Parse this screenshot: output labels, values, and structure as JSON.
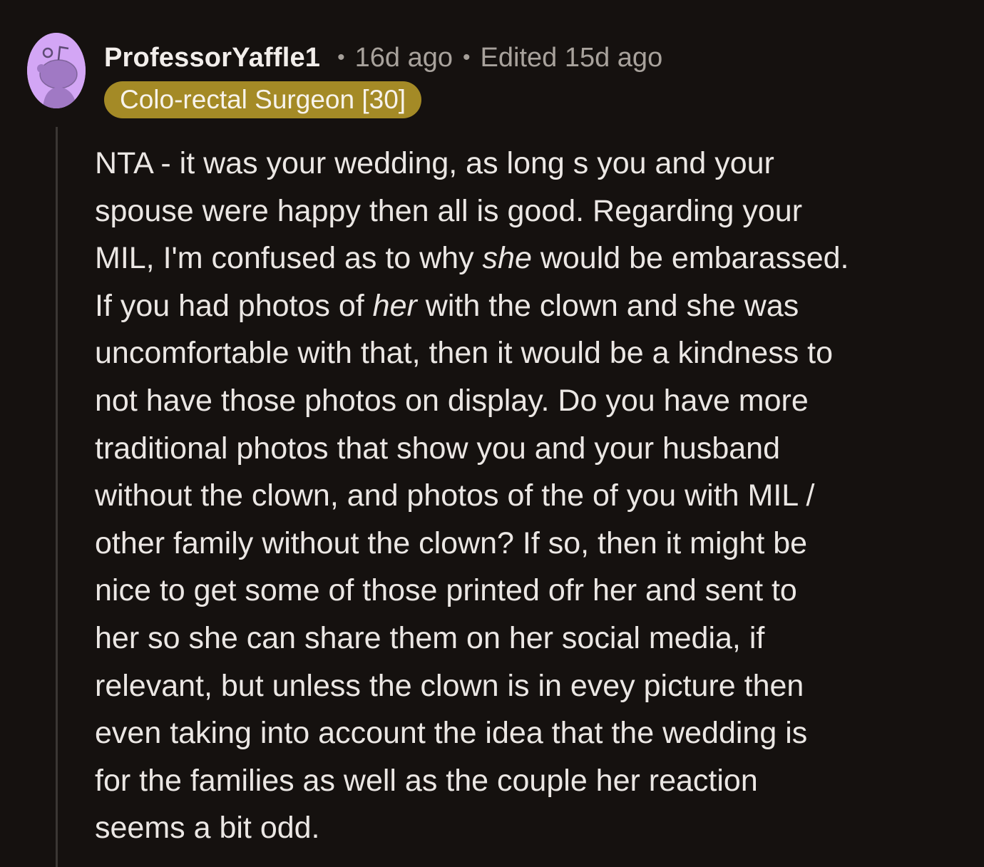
{
  "comment": {
    "username": "ProfessorYaffle1",
    "posted": "16d ago",
    "edited": "Edited 15d ago",
    "separator": "•",
    "flair": "Colo-rectal Surgeon [30]",
    "avatar_icon": "snoo-avatar-icon",
    "colors": {
      "background": "#15110f",
      "flair_bg": "#a48a26",
      "avatar_bg": "#d3a6f5",
      "text": "#ebe7e4",
      "meta": "#a8a29c"
    },
    "body_lines": [
      "NTA - it was your wedding, as long s you and your",
      "spouse were happy then all is good. Regarding your",
      [
        "MIL, I'm confused as to why ",
        "she",
        " would be embarassed."
      ],
      [
        "If you had photos of ",
        "her",
        " with the clown and she was"
      ],
      "uncomfortable with that, then it would be a kindness to",
      "not have those photos on display. Do you have more",
      "traditional photos that show you and your husband",
      "without the clown, and photos of the of you with MIL /",
      "other family without the clown? If so, then it might be",
      "nice to get some of those printed ofr her and sent to",
      "her so she can share them on her social media, if",
      "relevant, but unless the clown is in evey picture then",
      "even taking into account the idea that the wedding is",
      "for the families as well as the couple her reaction",
      "seems a bit odd."
    ]
  }
}
